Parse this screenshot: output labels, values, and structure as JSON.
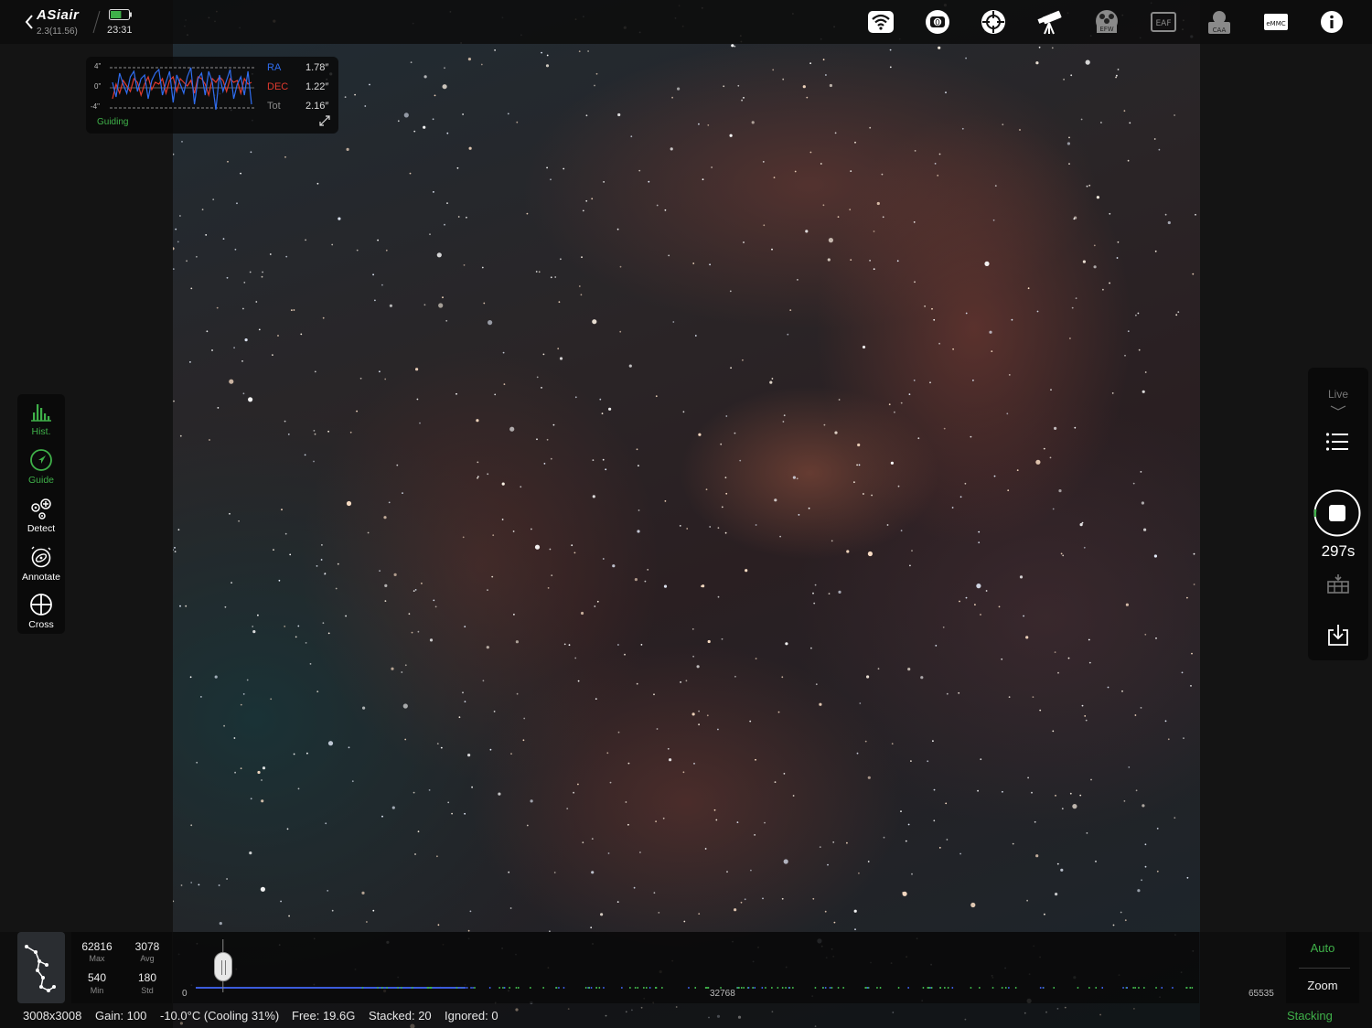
{
  "colors": {
    "accent": "#3fb049",
    "ra": "#2f6df0",
    "dec": "#e03a2e",
    "icon": "#ffffff",
    "dim": "#8a8a8a"
  },
  "topbar": {
    "app_name": "ASiair",
    "version": "2.3(11.56)",
    "clock": "23:31",
    "battery_level": 0.6,
    "icons": [
      "wifi-icon",
      "camera-icon",
      "guide-camera-icon",
      "telescope-icon",
      "efw-icon",
      "eaf-icon",
      "caa-icon",
      "emmc-icon",
      "info-icon"
    ],
    "efw_label": "EFW",
    "eaf_label": "EAF",
    "caa_label": "CAA",
    "emmc_label": "eMMC",
    "camera_label": "0"
  },
  "guiding": {
    "title": "Guiding",
    "y_ticks": [
      "4\"",
      "0\"",
      "-4\""
    ],
    "ra_label": "RA",
    "ra_value": "1.78″",
    "dec_label": "DEC",
    "dec_value": "1.22″",
    "tot_label": "Tot",
    "tot_value": "2.16″",
    "ra_series": [
      0.3,
      -0.5,
      0.8,
      0.2,
      -0.3,
      0.6,
      0.9,
      -0.2,
      0.5,
      0.7,
      -0.6,
      0.4,
      0.8,
      1.0,
      -0.4,
      0.3,
      0.9,
      -0.8,
      0.7,
      0.2,
      -0.3,
      0.6,
      1.1,
      -0.9,
      0.5,
      0.8,
      -0.4,
      0.9,
      0.3,
      -1.2,
      0.7,
      -0.2,
      0.4,
      1.0,
      -0.6,
      0.2,
      0.6,
      -0.4,
      0.9,
      -0.9
    ],
    "dec_series": [
      -0.6,
      0.2,
      -0.3,
      0.4,
      0.1,
      -0.2,
      0.5,
      0.3,
      -0.4,
      0.2,
      0.6,
      -0.1,
      0.3,
      0.2,
      0.5,
      -0.3,
      0.4,
      0.6,
      -0.2,
      0.5,
      0.3,
      0.1,
      0.4,
      -0.3,
      0.6,
      0.5,
      0.2,
      -0.4,
      0.5,
      0.3,
      0.6,
      0.4,
      -0.2,
      0.5,
      0.3,
      0.4,
      -0.3,
      0.5,
      0.2,
      0.3
    ]
  },
  "left_tools": [
    {
      "label": "Hist.",
      "active": true
    },
    {
      "label": "Guide",
      "active": true
    },
    {
      "label": "Detect",
      "active": false
    },
    {
      "label": "Annotate",
      "active": false
    },
    {
      "label": "Cross",
      "active": false
    }
  ],
  "right_panel": {
    "live_label": "Live",
    "countdown": "297s"
  },
  "stats": {
    "max": "62816",
    "max_label": "Max",
    "avg": "3078",
    "avg_label": "Avg",
    "min": "540",
    "min_label": "Min",
    "std": "180",
    "std_label": "Std"
  },
  "histogram": {
    "tick_min": "0",
    "tick_mid": "32768",
    "tick_max": "65535",
    "black_point": 0.031
  },
  "bottom_buttons": {
    "auto": "Auto",
    "zoom": "Zoom"
  },
  "status": {
    "resolution": "3008x3008",
    "gain": "Gain: 100",
    "temp": "-10.0°C (Cooling 31%)",
    "free": "Free: 19.6G",
    "stacked": "Stacked: 20",
    "ignored": "Ignored: 0",
    "mode": "Stacking"
  }
}
